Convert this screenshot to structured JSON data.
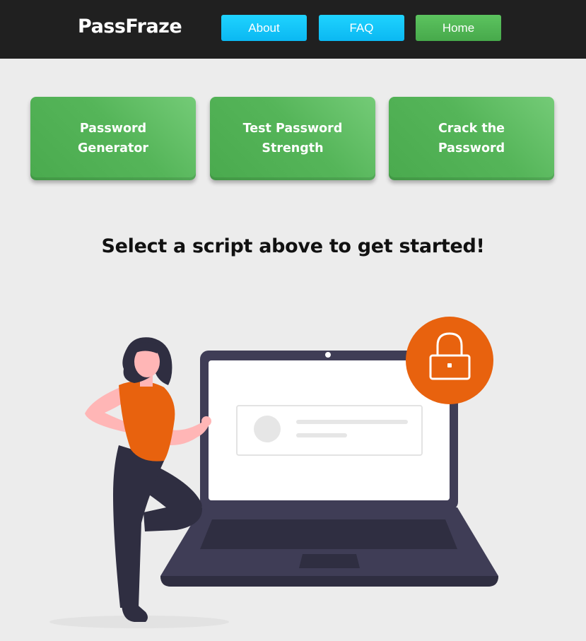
{
  "header": {
    "brand": "PassFraze",
    "nav": {
      "about": "About",
      "faq": "FAQ",
      "home": "Home"
    }
  },
  "cards": {
    "generator": "Password\nGenerator",
    "strength": "Test Password\nStrength",
    "crack": "Crack the\nPassword"
  },
  "main": {
    "headline": "Select a script above to get started!"
  },
  "icons": {
    "lock": "lock-icon"
  },
  "colors": {
    "topbar": "#202020",
    "nav_blue": "#0bb8f2",
    "nav_green": "#4caf50",
    "card_green": "#55b559",
    "accent_orange": "#e8620e",
    "laptop": "#3f3d56"
  }
}
